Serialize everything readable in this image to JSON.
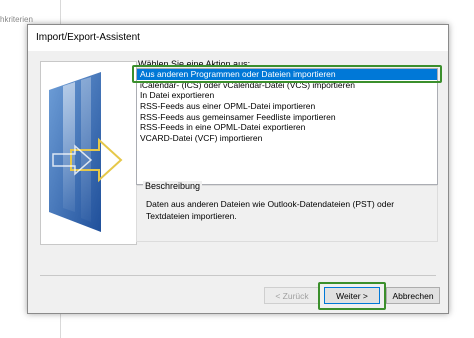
{
  "background": {
    "truncated_text": "hkriterien"
  },
  "dialog": {
    "title": "Import/Export-Assistent",
    "action_label": "Wählen Sie eine Aktion aus:",
    "actions": [
      "Aus anderen Programmen oder Dateien importieren",
      "iCalendar- (ICS) oder vCalendar-Datei (VCS) importieren",
      "In Datei exportieren",
      "RSS-Feeds aus einer OPML-Datei importieren",
      "RSS-Feeds aus gemeinsamer Feedliste importieren",
      "RSS-Feeds in eine OPML-Datei exportieren",
      "VCARD-Datei (VCF) importieren"
    ],
    "selected_index": 0,
    "description_title": "Beschreibung",
    "description_text": "Daten aus anderen Dateien wie Outlook-Datendateien (PST) oder Textdateien importieren.",
    "buttons": {
      "back": "< Zurück",
      "next": "Weiter >",
      "cancel": "Abbrechen"
    }
  },
  "colors": {
    "selection": "#0078d7",
    "highlight": "#3b8f2c",
    "dialog_bg": "#f0f0f0"
  },
  "icons": {
    "side_image": "wizard-arrow-graphic"
  }
}
